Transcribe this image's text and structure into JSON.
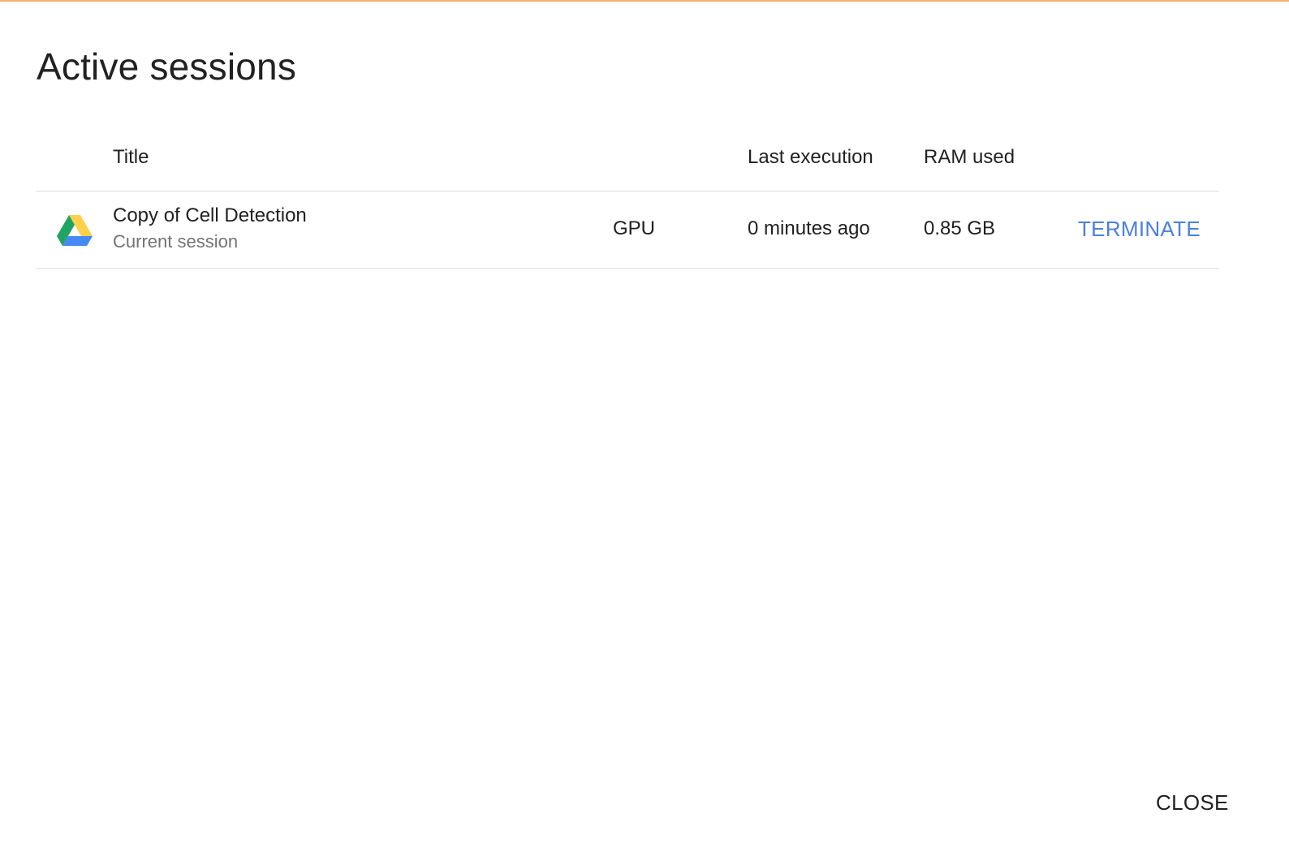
{
  "dialog": {
    "title": "Active sessions",
    "close_label": "CLOSE"
  },
  "table": {
    "headers": {
      "title": "Title",
      "type": "",
      "last_execution": "Last execution",
      "ram_used": "RAM used"
    },
    "rows": [
      {
        "icon": "google-drive-icon",
        "title": "Copy of Cell Detection",
        "subtitle": "Current session",
        "accelerator": "GPU",
        "last_execution": "0 minutes ago",
        "ram_used": "0.85 GB",
        "action_label": "TERMINATE"
      }
    ]
  },
  "colors": {
    "accent_top": "#f4b26a",
    "link": "#4a7fe0",
    "drive_green": "#1fa463",
    "drive_yellow": "#ffd04b",
    "drive_blue": "#4688f4"
  }
}
